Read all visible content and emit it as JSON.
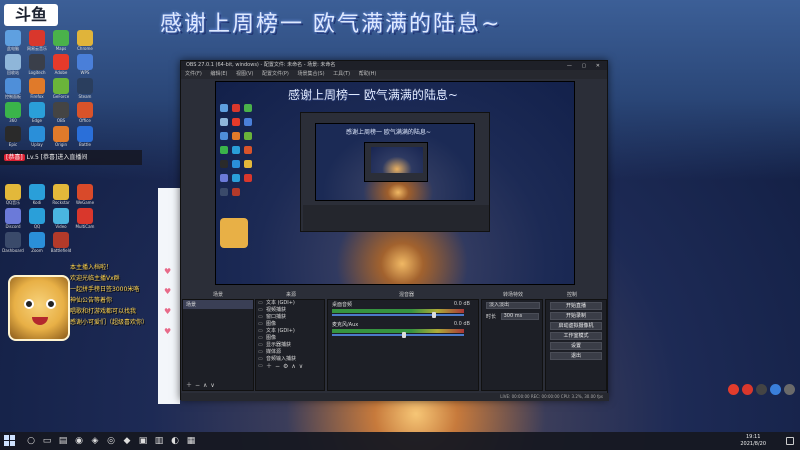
{
  "stream_title": "感谢上周榜一 欧气满满的陆息~",
  "brand_logo": "斗鱼",
  "notice": {
    "tag": "[恭喜]",
    "text": "Lv.5 [恭喜]进入直播间"
  },
  "danmaku": [
    "本主播入档啦！",
    "欢迎光临主播Vx群",
    "一起拼手榜日签3000米咯",
    "神仙公告等着你",
    "唱歌和打游戏都可以找我",
    "感谢小可爱们（超级喜欢你）"
  ],
  "desktop_icons": [
    {
      "label": "此电脑",
      "color": "#5fa0e0"
    },
    {
      "label": "网易云音乐",
      "color": "#d9372c"
    },
    {
      "label": "Maps",
      "color": "#4ab24a"
    },
    {
      "label": "Chrome",
      "color": "#e0b43a"
    },
    {
      "label": "回收站",
      "color": "#8fb6d9"
    },
    {
      "label": "Logitech",
      "color": "#3a3f4a"
    },
    {
      "label": "Adobe",
      "color": "#e63a2a"
    },
    {
      "label": "WPS",
      "color": "#4a7fd9"
    },
    {
      "label": "控制面板",
      "color": "#4f8fd9"
    },
    {
      "label": "Firefox",
      "color": "#e07a2a"
    },
    {
      "label": "GeForce",
      "color": "#6ab43a"
    },
    {
      "label": "Steam",
      "color": "#2a3e5e"
    },
    {
      "label": "360",
      "color": "#3ab44a"
    },
    {
      "label": "Edge",
      "color": "#2a9fd9"
    },
    {
      "label": "OBS",
      "color": "#444"
    },
    {
      "label": "Office",
      "color": "#d9532a"
    },
    {
      "label": "Epic",
      "color": "#2a2a2a"
    },
    {
      "label": "Uplay",
      "color": "#2a8fd9"
    },
    {
      "label": "Origin",
      "color": "#e07a2a"
    },
    {
      "label": "Battle",
      "color": "#2a6fd9"
    },
    {
      "label": "QQ音乐",
      "color": "#e3b83a"
    },
    {
      "label": "Kodi",
      "color": "#2a9fd9"
    },
    {
      "label": "Rockstar",
      "color": "#e3b83a"
    },
    {
      "label": "WeGame",
      "color": "#d94a2a"
    },
    {
      "label": "Discord",
      "color": "#6b7ad9"
    },
    {
      "label": "QQ",
      "color": "#2a9fd9"
    },
    {
      "label": "Video",
      "color": "#4ab4e0"
    },
    {
      "label": "MultiCam",
      "color": "#d9372c"
    },
    {
      "label": "Dashboard",
      "color": "#3a4a6a"
    },
    {
      "label": "Zoom",
      "color": "#2a8fd9"
    },
    {
      "label": "Battlefield",
      "color": "#b33a2a"
    }
  ],
  "obs": {
    "title": "OBS 27.0.1 (64-bit, windows) - 配置文件: 未命名 - 场景: 未命名",
    "menu": [
      "文件(F)",
      "编辑(E)",
      "视图(V)",
      "配置文件(P)",
      "场景集合(S)",
      "工具(T)",
      "帮助(H)"
    ],
    "preview_title": "感谢上周榜一 欧气满满的陆息~",
    "panels": {
      "scenes": "场景",
      "sources": "来源",
      "mixer": "混音器",
      "transitions": "转场特效",
      "controls": "控制"
    },
    "scene_items": [
      "场景"
    ],
    "source_items": [
      "文本 (GDI+)",
      "视频捕获",
      "窗口捕获",
      "图像",
      "文本 (GDI+)",
      "图像",
      "显示器捕获",
      "媒体源",
      "音频输入捕获"
    ],
    "mixer_tracks": [
      {
        "name": "桌面音频",
        "db": "0.0 dB",
        "level": 0.78
      },
      {
        "name": "麦克风/Aux",
        "db": "0.0 dB",
        "level": 0.55
      }
    ],
    "transition": {
      "type": "淡入淡出",
      "duration_label": "时长",
      "duration": "300 ms"
    },
    "controls": [
      "开始直播",
      "开始录制",
      "启动虚拟摄像机",
      "工作室模式",
      "设置",
      "退出"
    ],
    "status": "LIVE: 00:00:00   REC: 00:00:00   CPU: 3.2%, 30.00 fps"
  },
  "taskbar": {
    "time": "19:11",
    "date": "2021/8/20"
  }
}
